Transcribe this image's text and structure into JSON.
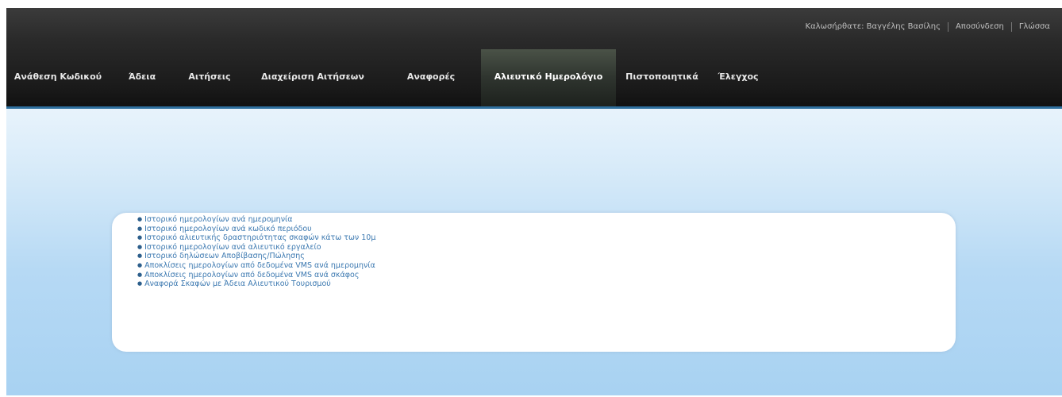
{
  "header": {
    "user_label": "Καλωσήρθατε: Βαγγέλης Βασίλης",
    "logout_label": "Αποσύνδεση",
    "language_label": "Γλώσσα"
  },
  "nav": {
    "items": [
      {
        "label": "Ανάθεση Κωδικού"
      },
      {
        "label": "Άδεια"
      },
      {
        "label": "Αιτήσεις"
      },
      {
        "label": "Διαχείριση Αιτήσεων"
      },
      {
        "label": "Αναφορές"
      },
      {
        "label": "Αλιευτικό Ημερολόγιο",
        "active": true
      },
      {
        "label": "Πιστοποιητικά"
      },
      {
        "label": "Έλεγχος"
      }
    ]
  },
  "main": {
    "links": [
      "Ιστορικό ημερολογίων ανά ημερομηνία",
      "Ιστορικό ημερολογίων ανά κωδικό περιόδου",
      "Ιστορικό αλιευτικής δραστηριότητας σκαφών κάτω των 10μ",
      "Ιστορικό ημερολογίων ανά αλιευτικό εργαλείο",
      "Ιστορικό δηλώσεων Αποβίβασης/Πώλησης",
      "Αποκλίσεις ημερολογίων από δεδομένα VMS ανά ημερομηνία",
      "Αποκλίσεις ημερολογίων από δεδομένα VMS ανά σκάφος",
      "Αναφορά Σκαφών με Άδεια Αλιευτικού Τουρισμού"
    ]
  },
  "colors": {
    "topbar": "#1a1a1a",
    "link": "#3b78b0",
    "accent_line": "#2e6f9e"
  }
}
